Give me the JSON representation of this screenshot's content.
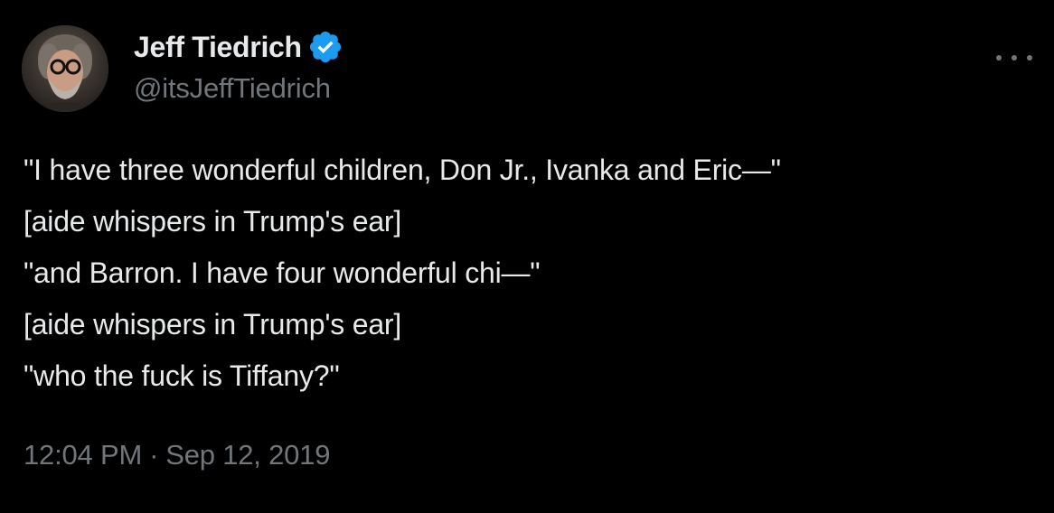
{
  "author": {
    "display_name": "Jeff Tiedrich",
    "handle": "@itsJeffTiedrich",
    "verified": true
  },
  "tweet": {
    "lines": [
      "\"I have three wonderful children, Don Jr., Ivanka and Eric—\"",
      "[aide whispers in Trump's ear]",
      "\"and Barron. I have four wonderful chi—\"",
      "[aide whispers in Trump's ear]",
      "\"who the fuck is Tiffany?\""
    ],
    "time": "12:04 PM",
    "separator": "·",
    "date": "Sep 12, 2019"
  },
  "icons": {
    "verified": "verified-badge-icon",
    "more": "more-options-icon"
  },
  "colors": {
    "background": "#000000",
    "primary_text": "#e7e9ea",
    "secondary_text": "#71767b",
    "verified_blue": "#1d9bf0"
  }
}
